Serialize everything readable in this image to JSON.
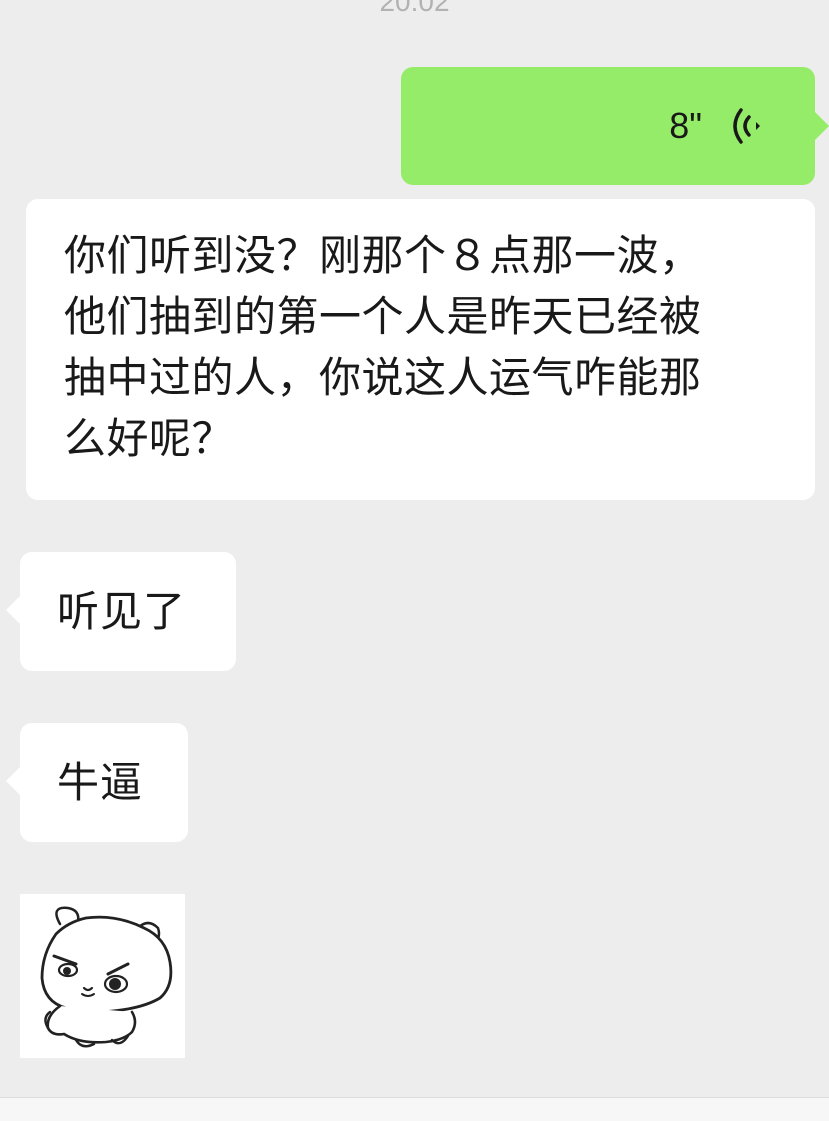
{
  "timestamp": "20:02",
  "messages": [
    {
      "type": "voice",
      "side": "right",
      "duration": "8\"",
      "icon": "voice-wave-icon"
    },
    {
      "type": "text",
      "side": "left",
      "lines": [
        "你们听到没？刚那个８点那一波，",
        "他们抽到的第一个人是昨天已经被",
        "抽中过的人，你说这人运气咋能那",
        "么好呢？"
      ]
    },
    {
      "type": "text",
      "side": "left",
      "text": "听见了"
    },
    {
      "type": "text",
      "side": "left",
      "text": "牛逼"
    },
    {
      "type": "sticker",
      "side": "left",
      "icon": "angry-bear-sticker"
    }
  ],
  "colors": {
    "background": "#ededed",
    "sent_bubble": "#95ec69",
    "received_bubble": "#ffffff",
    "text": "#191919"
  }
}
